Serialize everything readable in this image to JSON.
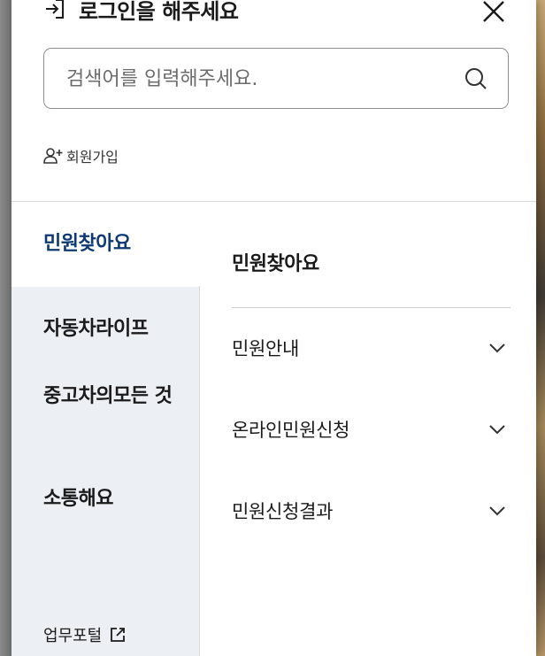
{
  "header": {
    "login_label": "로그인을 해주세요",
    "close_icon": "close-icon",
    "login_icon": "login-arrow-icon"
  },
  "search": {
    "placeholder": "검색어를 입력해주세요.",
    "value": "",
    "icon": "search-icon"
  },
  "signup": {
    "label": "회원가입",
    "icon": "add-user-icon"
  },
  "categories": [
    {
      "label": "민원찾아요",
      "active": true
    },
    {
      "label": "자동차라이프",
      "active": false
    },
    {
      "label": "중고차의모든 것",
      "active": false
    },
    {
      "label": "소통해요",
      "active": false
    }
  ],
  "portal": {
    "label": "업무포털",
    "icon": "external-link-icon"
  },
  "submenu": {
    "title": "민원찾아요",
    "items": [
      {
        "label": "민원안내",
        "icon": "chevron-down-icon"
      },
      {
        "label": "온라인민원신청",
        "icon": "chevron-down-icon"
      },
      {
        "label": "민원신청결과",
        "icon": "chevron-down-icon"
      }
    ]
  },
  "colors": {
    "active_category": "#0d3a73",
    "category_bg": "#ecf0f4",
    "panel_bg": "#ffffff",
    "border": "#8e8e8e"
  }
}
